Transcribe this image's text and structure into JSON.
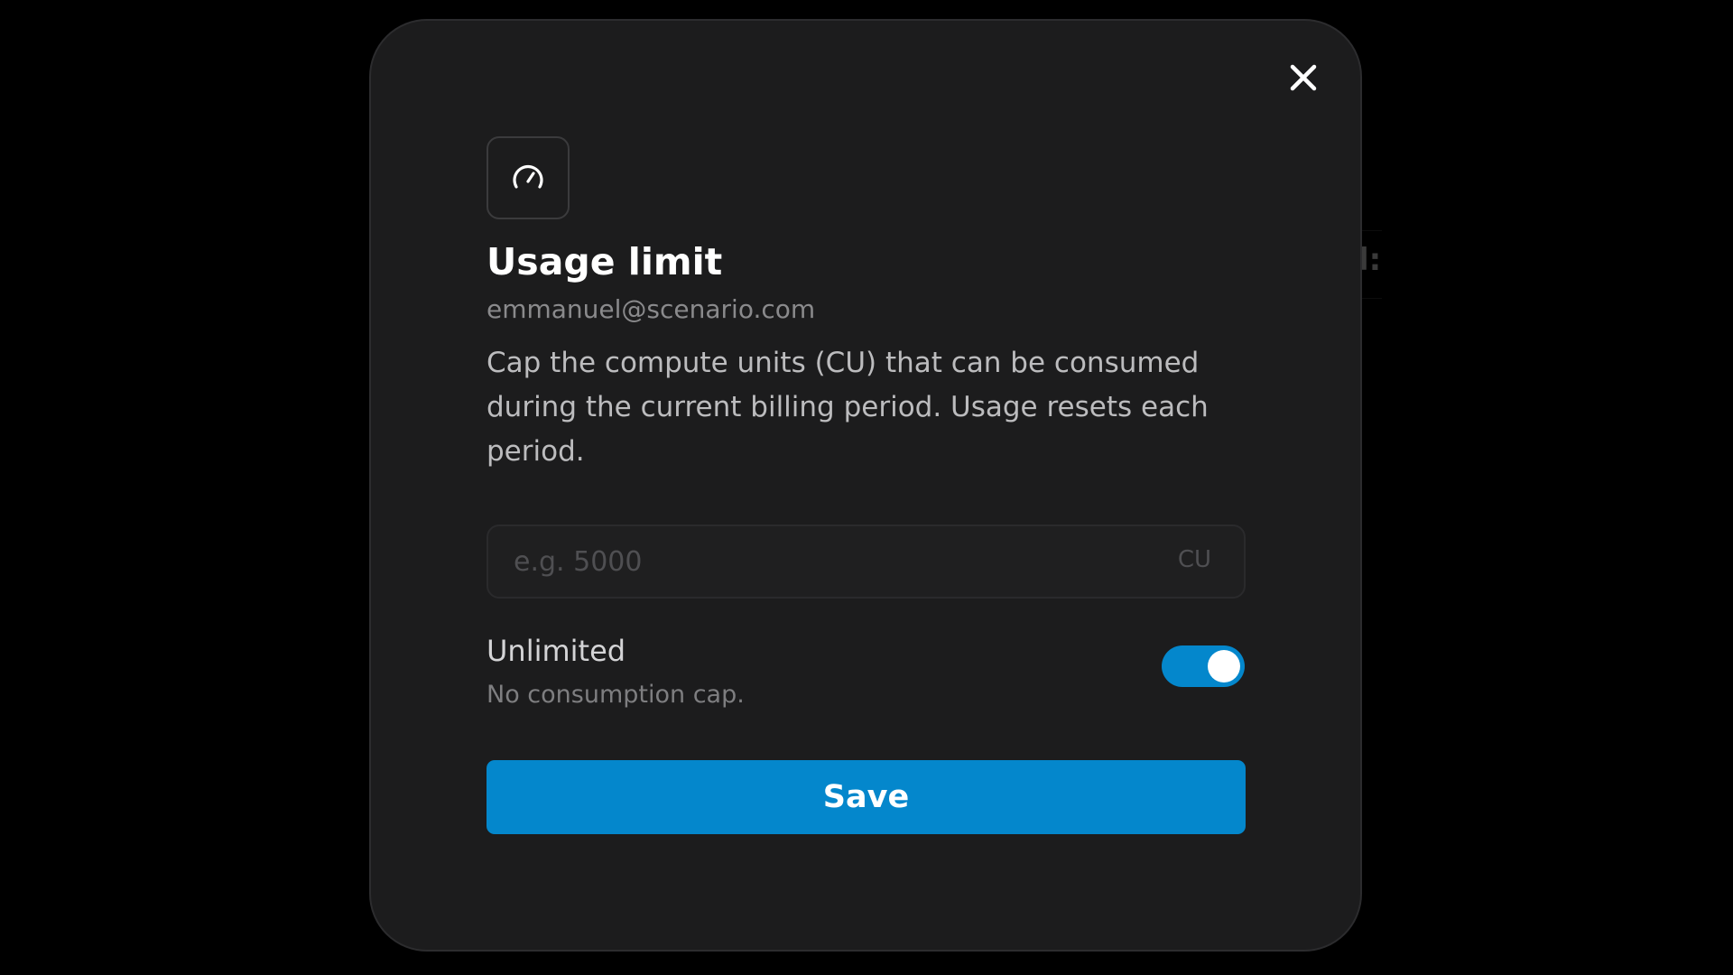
{
  "dialog": {
    "title": "Usage limit",
    "email": "emmanuel@scenario.com",
    "description": "Cap the compute units (CU) that can be consumed during the current billing period. Usage resets each period.",
    "header_icon": "speedometer-gauge-icon",
    "close_icon": "close-icon"
  },
  "limit_input": {
    "value": "",
    "placeholder": "e.g. 5000",
    "unit": "CU"
  },
  "unlimited": {
    "label": "Unlimited",
    "sublabel": "No consumption cap.",
    "enabled": true
  },
  "save_button": {
    "label": "Save"
  },
  "background": {
    "partial_text": "l:"
  },
  "colors": {
    "accent": "#0487cc",
    "modal_bg": "#1c1c1d",
    "page_bg": "#000000"
  }
}
